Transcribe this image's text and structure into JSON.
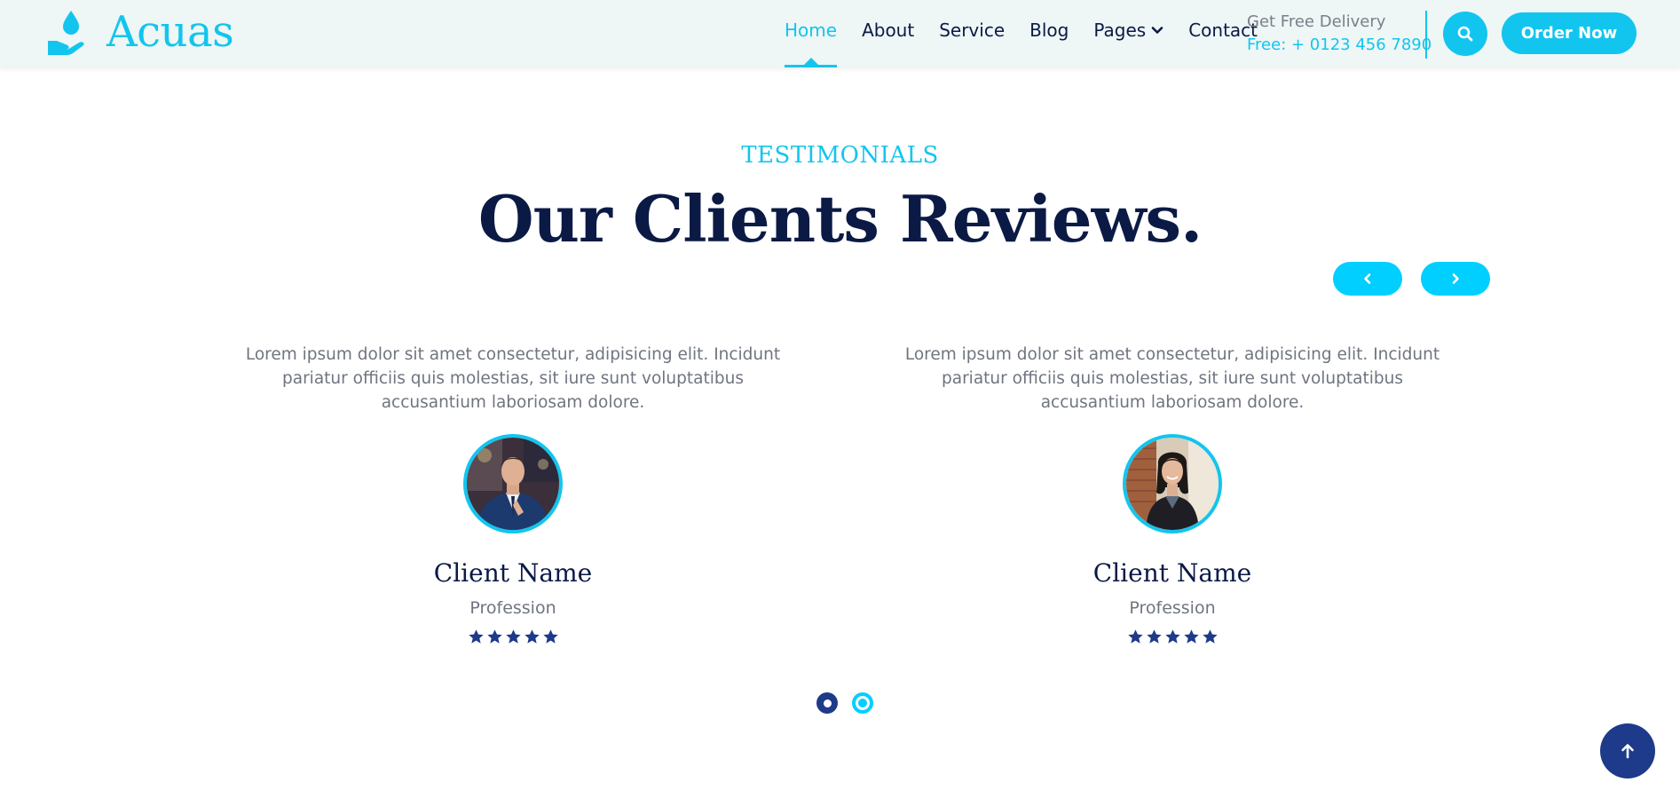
{
  "brand": {
    "name": "Acuas",
    "accent_color": "#12c5ee",
    "dark_color": "#0b1a45",
    "navy_color": "#1e3a8a"
  },
  "nav": {
    "items": [
      {
        "label": "Home",
        "active": true
      },
      {
        "label": "About"
      },
      {
        "label": "Service"
      },
      {
        "label": "Blog"
      },
      {
        "label": "Pages",
        "has_dropdown": true,
        "icon": "chevron-down-icon"
      },
      {
        "label": "Contact"
      }
    ]
  },
  "delivery": {
    "line1": "Get Free Delivery",
    "line2": "Free: + 0123 456 7890"
  },
  "header_actions": {
    "search_icon": "search-icon",
    "order_label": "Order Now"
  },
  "section": {
    "eyebrow": "TESTIMONIALS",
    "title": "Our Clients Reviews."
  },
  "carousel": {
    "prev_icon": "chevron-left-icon",
    "next_icon": "chevron-right-icon",
    "active_dot": 1,
    "dot_count": 2
  },
  "testimonials": [
    {
      "quote": "Lorem ipsum dolor sit amet consectetur, adipisicing elit. Incidunt pariatur officiis quis molestias, sit iure sunt voluptatibus accusantium laboriosam dolore.",
      "name": "Client Name",
      "profession": "Profession",
      "rating": 5,
      "avatar": "man-in-suit-photo"
    },
    {
      "quote": "Lorem ipsum dolor sit amet consectetur, adipisicing elit. Incidunt pariatur officiis quis molestias, sit iure sunt voluptatibus accusantium laboriosam dolore.",
      "name": "Client Name",
      "profession": "Profession",
      "rating": 5,
      "avatar": "woman-smiling-photo"
    }
  ],
  "back_to_top_icon": "arrow-up-icon"
}
